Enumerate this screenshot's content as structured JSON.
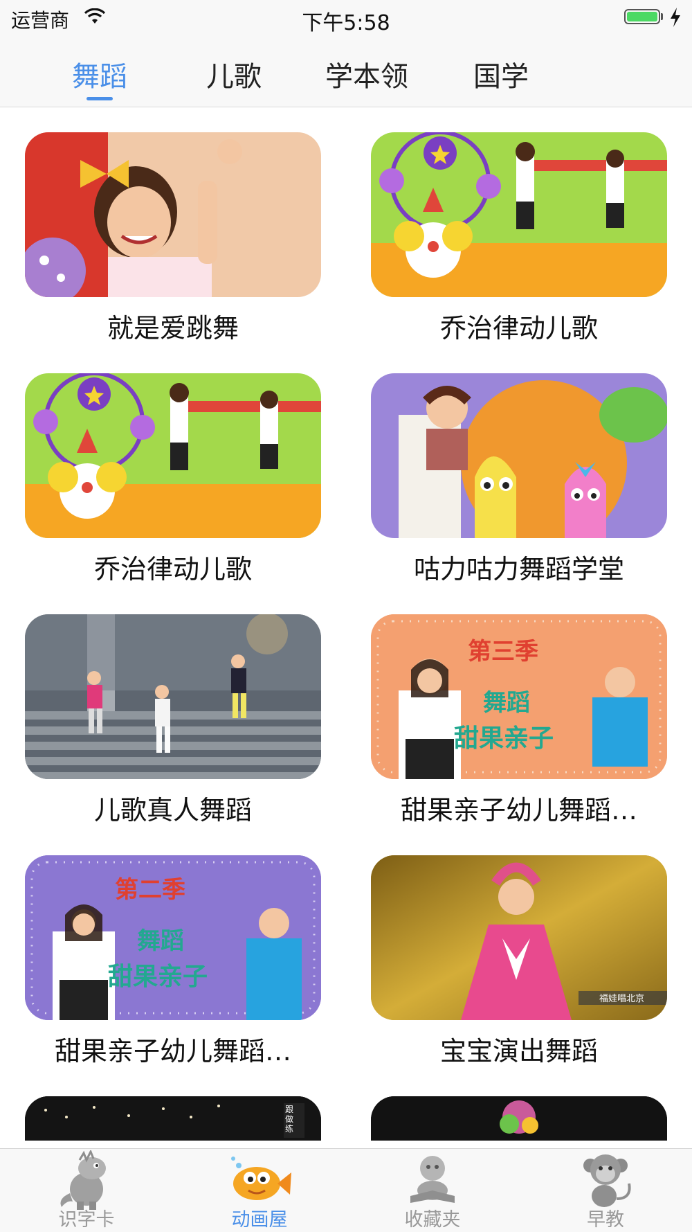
{
  "status_bar": {
    "carrier": "运营商",
    "time": "下午5:58"
  },
  "top_tabs": [
    {
      "label": "舞蹈",
      "active": true
    },
    {
      "label": "儿歌",
      "active": false
    },
    {
      "label": "学本领",
      "active": false
    },
    {
      "label": "国学",
      "active": false
    }
  ],
  "videos": [
    {
      "title": "就是爱跳舞"
    },
    {
      "title": "乔治律动儿歌"
    },
    {
      "title": "乔治律动儿歌"
    },
    {
      "title": "咕力咕力舞蹈学堂"
    },
    {
      "title": "儿歌真人舞蹈"
    },
    {
      "title": "甜果亲子幼儿舞蹈…"
    },
    {
      "title": "甜果亲子幼儿舞蹈…"
    },
    {
      "title": "宝宝演出舞蹈"
    }
  ],
  "thumb_text": {
    "season3": "第三季",
    "season2": "第二季",
    "dance": "舞蹈",
    "brand": "甜果亲子",
    "caption": "福娃唱北京",
    "follow": "跟做练"
  },
  "tab_bar": [
    {
      "label": "识字卡",
      "icon": "dinosaur-icon",
      "active": false
    },
    {
      "label": "动画屋",
      "icon": "fish-icon",
      "active": true
    },
    {
      "label": "收藏夹",
      "icon": "reading-child-icon",
      "active": false
    },
    {
      "label": "早教",
      "icon": "monkey-icon",
      "active": false
    }
  ],
  "colors": {
    "accent": "#4a8fe8",
    "battery": "#4cd964"
  }
}
